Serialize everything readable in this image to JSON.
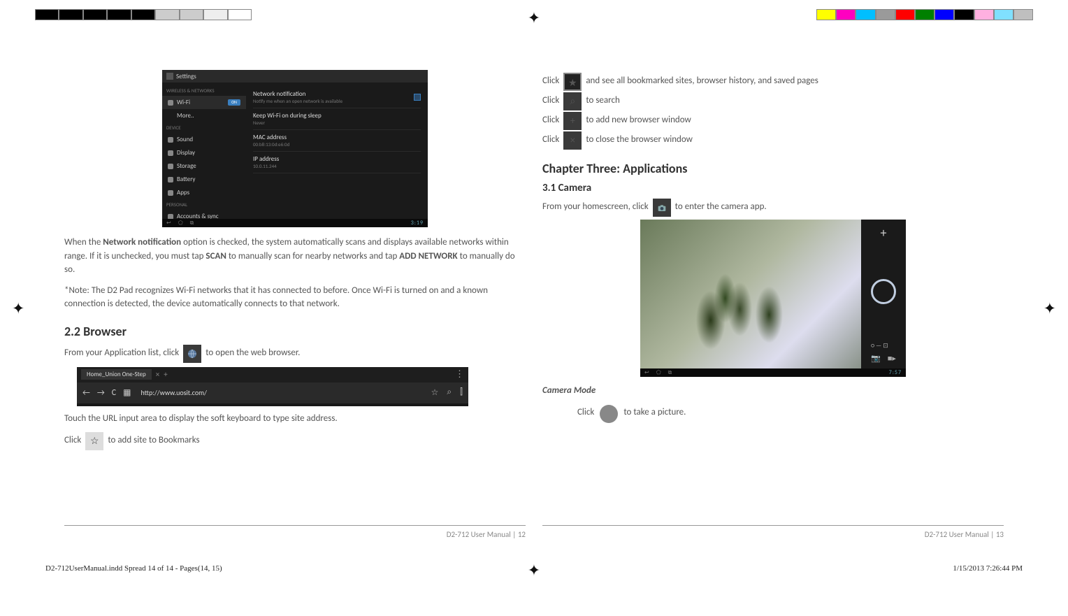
{
  "reg_colors_left": [
    "#000",
    "#000",
    "#000",
    "#000",
    "#000",
    "#ccc",
    "#ccc",
    "#eee",
    "#fff"
  ],
  "reg_colors_right": [
    "#ffff00",
    "#ff00c0",
    "#00bfff",
    "#9a9a9a",
    "#ff0000",
    "#008000",
    "#0000ff",
    "#000000",
    "#ffb0e0",
    "#80e0ff",
    "#bfbfbf"
  ],
  "left_page": {
    "settings": {
      "titlebar": "Settings",
      "side_header1": "WIRELESS & NETWORKS",
      "wifi": "Wi-Fi",
      "wifi_state": "ON",
      "more": "More..",
      "side_header2": "DEVICE",
      "sound": "Sound",
      "display": "Display",
      "storage": "Storage",
      "battery": "Battery",
      "apps": "Apps",
      "side_header3": "PERSONAL",
      "accounts": "Accounts & sync",
      "nn_title": "Network notification",
      "nn_sub": "Notify me when an open network is available",
      "ks_title": "Keep Wi-Fi on during sleep",
      "ks_sub": "Never",
      "mac_title": "MAC address",
      "mac_sub": "00:b8:13:0d:e6:0d",
      "ip_title": "IP address",
      "ip_sub": "10.0.11.244",
      "clock": "3:19"
    },
    "p1a": "When the ",
    "p1b": "Network notification",
    "p1c": " option is checked, the system automatically scans and displays available networks within range. If it is unchecked, you must tap ",
    "p1d": "SCAN",
    "p1e": " to manually scan for nearby networks and tap ",
    "p1f": "ADD NETWORK",
    "p1g": " to manually do so.",
    "p2": "*Note: The D2 Pad recognizes Wi-Fi networks that it has connected to before. Once Wi-Fi is turned on and a known connection is detected, the device automatically connects to that network.",
    "h_browser": "2.2 Browser",
    "p3a": "From your Application list, click ",
    "p3b": " to open the web browser.",
    "browser": {
      "tab": "Home_Union One-Step",
      "url": "http://www.uosit.com/"
    },
    "p4": "Touch the URL input area to display the soft keyboard to type site address.",
    "p5a": "Click ",
    "p5b": " to add site to Bookmarks",
    "footer": "D2-712 User Manual | 12"
  },
  "right_page": {
    "r1a": "Click ",
    "r1b": " and see all bookmarked sites, browser history, and saved pages",
    "r2a": "Click ",
    "r2b": " to search",
    "r3a": "Click ",
    "r3b": " to add new browser window",
    "r4a": "Click ",
    "r4b": " to close the browser window",
    "h_ch3": "Chapter Three: Applications",
    "h_cam": "3.1 Camera",
    "p_cam_a": "From your homescreen, click ",
    "p_cam_b": " to enter the camera app.",
    "camera": {
      "clock": "7:57"
    },
    "cm_title": "Camera Mode",
    "cm_a": "Click ",
    "cm_b": " to take a picture.",
    "footer": "D2-712 User Manual | 13"
  },
  "meta": {
    "file": "D2-712UserManual.indd   Spread 14 of 14 - Pages(14, 15)",
    "date": "1/15/2013   7:26:44 PM"
  }
}
